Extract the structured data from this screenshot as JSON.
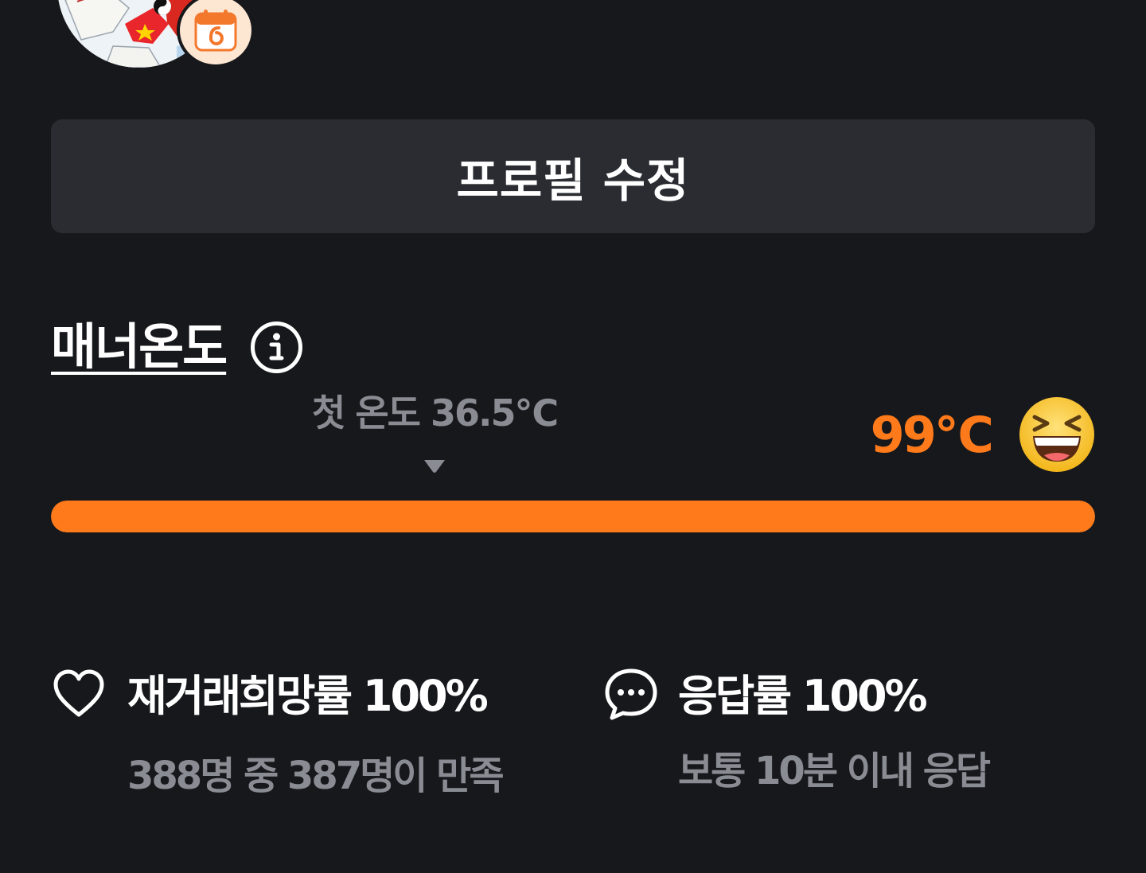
{
  "profile": {
    "avatar_alt": "profile-avatar",
    "badge_icon": "calendar-badge-icon",
    "edit_button_label": "프로필 수정"
  },
  "manner": {
    "title": "매너온도",
    "info_icon": "info-icon",
    "first_temperature_label": "첫 온도 36.5℃",
    "current_temperature": "99℃",
    "current_temperature_value": 99,
    "gauge_fill_fraction": 1.0,
    "emoji": "laughing-face-icon",
    "accent_color": "#ff7a1a",
    "gauge_track_color": "#3a3c42",
    "muted_text_color": "#8a8c93"
  },
  "stats": [
    {
      "icon": "heart-icon",
      "title": "재거래희망률 100%",
      "subtitle": "388명 중 387명이 만족"
    },
    {
      "icon": "chat-bubble-icon",
      "title": "응답률 100%",
      "subtitle": "보통 10분 이내 응답"
    }
  ]
}
